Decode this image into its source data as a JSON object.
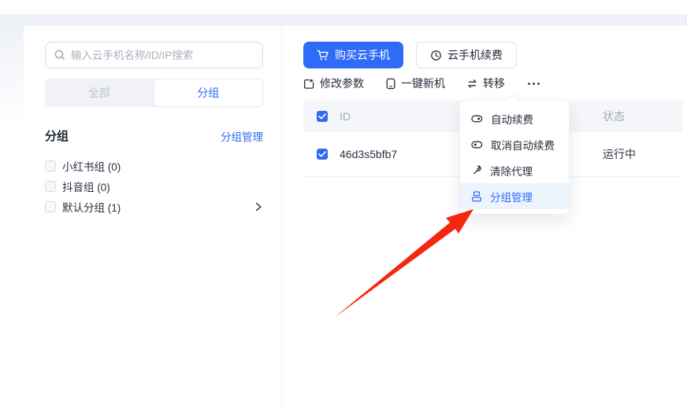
{
  "colors": {
    "accent": "#2e6bf6",
    "arrow_red": "#f5270f"
  },
  "sidebar": {
    "search_placeholder": "输入云手机名称/ID/IP搜索",
    "search_icon": "search-icon",
    "tabs": [
      {
        "label": "全部",
        "active": false
      },
      {
        "label": "分组",
        "active": true
      }
    ],
    "group_title": "分组",
    "group_manage_link": "分组管理",
    "groups": [
      {
        "label": "小红书组 (0)",
        "checked": false,
        "expandable": false
      },
      {
        "label": "抖音组 (0)",
        "checked": false,
        "expandable": false
      },
      {
        "label": "默认分组 (1)",
        "checked": false,
        "expandable": true,
        "chevron_icon": "chevron-right-icon"
      }
    ]
  },
  "main": {
    "buttons": {
      "buy": {
        "label": "购买云手机",
        "icon": "cart-icon"
      },
      "renew": {
        "label": "云手机续费",
        "icon": "clock-renew-icon"
      }
    },
    "toolbar": {
      "items": [
        {
          "label": "修改参数",
          "icon": "edit-square-icon"
        },
        {
          "label": "一键新机",
          "icon": "phone-icon"
        },
        {
          "label": "转移",
          "icon": "transfer-arrows-icon"
        }
      ],
      "more_icon": "more-dots-icon"
    },
    "table": {
      "select_all_checked": true,
      "columns": [
        "ID",
        "状态"
      ],
      "rows": [
        {
          "checked": true,
          "id": "46d3s5bfb7",
          "status": "运行中"
        }
      ]
    }
  },
  "dropdown": {
    "items": [
      {
        "label": "自动续费",
        "icon": "toggle-on-icon",
        "active": false
      },
      {
        "label": "取消自动续费",
        "icon": "toggle-off-icon",
        "active": false
      },
      {
        "label": "清除代理",
        "icon": "wrench-icon",
        "active": false
      },
      {
        "label": "分组管理",
        "icon": "group-grid-icon",
        "active": true
      }
    ]
  },
  "annotation": {
    "type": "red-pointer-arrow",
    "color": "#f5270f"
  }
}
